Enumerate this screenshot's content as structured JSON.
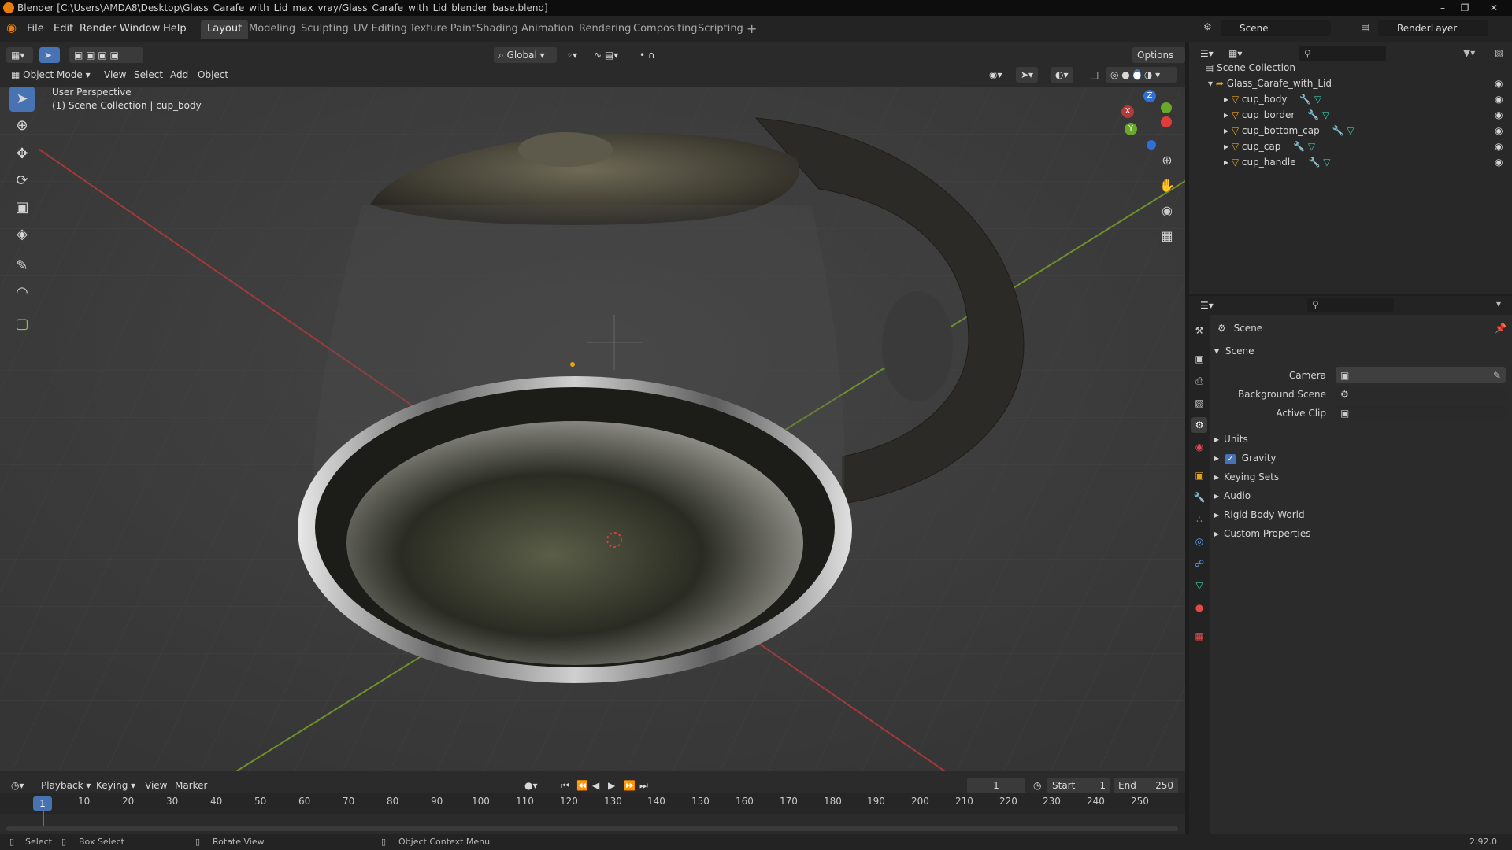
{
  "window": {
    "title": "Blender [C:\\Users\\AMDA8\\Desktop\\Glass_Carafe_with_Lid_max_vray/Glass_Carafe_with_Lid_blender_base.blend]"
  },
  "menus": [
    "File",
    "Edit",
    "Render",
    "Window",
    "Help"
  ],
  "workspaces": [
    {
      "label": "Layout",
      "active": true
    },
    {
      "label": "Modeling"
    },
    {
      "label": "Sculpting"
    },
    {
      "label": "UV Editing"
    },
    {
      "label": "Texture Paint"
    },
    {
      "label": "Shading"
    },
    {
      "label": "Animation"
    },
    {
      "label": "Rendering"
    },
    {
      "label": "Compositing"
    },
    {
      "label": "Scripting"
    },
    {
      "label": "+"
    }
  ],
  "scene_field": "Scene",
  "layer_field": "RenderLayer",
  "viewport_header": {
    "mode": "Object Mode",
    "menus": [
      "View",
      "Select",
      "Add",
      "Object"
    ],
    "orientation": "Global",
    "options": "Options"
  },
  "viewport": {
    "perspective": "User Perspective",
    "collection_info": "(1) Scene Collection | cup_body"
  },
  "gizmo": {
    "x": "X",
    "y": "Y",
    "z": "Z"
  },
  "outliner": {
    "root": "Scene Collection",
    "collection": "Glass_Carafe_with_Lid",
    "objects": [
      "cup_body",
      "cup_border",
      "cup_bottom_cap",
      "cup_cap",
      "cup_handle"
    ]
  },
  "properties": {
    "header": "Scene",
    "panel": "Scene",
    "fields": [
      {
        "label": "Camera"
      },
      {
        "label": "Background Scene"
      },
      {
        "label": "Active Clip"
      }
    ],
    "sections": [
      "Units",
      "Gravity",
      "Keying Sets",
      "Audio",
      "Rigid Body World",
      "Custom Properties"
    ],
    "gravity_checked": true
  },
  "timeline": {
    "menus": [
      "Playback",
      "Keying",
      "View",
      "Marker"
    ],
    "current_frame": "1",
    "start_label": "Start",
    "start": "1",
    "end_label": "End",
    "end": "250",
    "ruler": [
      "10",
      "20",
      "30",
      "40",
      "50",
      "60",
      "70",
      "80",
      "90",
      "100",
      "110",
      "120",
      "130",
      "140",
      "150",
      "160",
      "170",
      "180",
      "190",
      "200",
      "210",
      "220",
      "230",
      "240",
      "250"
    ],
    "cursor_frame": "1"
  },
  "statusbar": {
    "select": "Select",
    "box_select": "Box Select",
    "rotate": "Rotate View",
    "context": "Object Context Menu",
    "version": "2.92.0"
  }
}
